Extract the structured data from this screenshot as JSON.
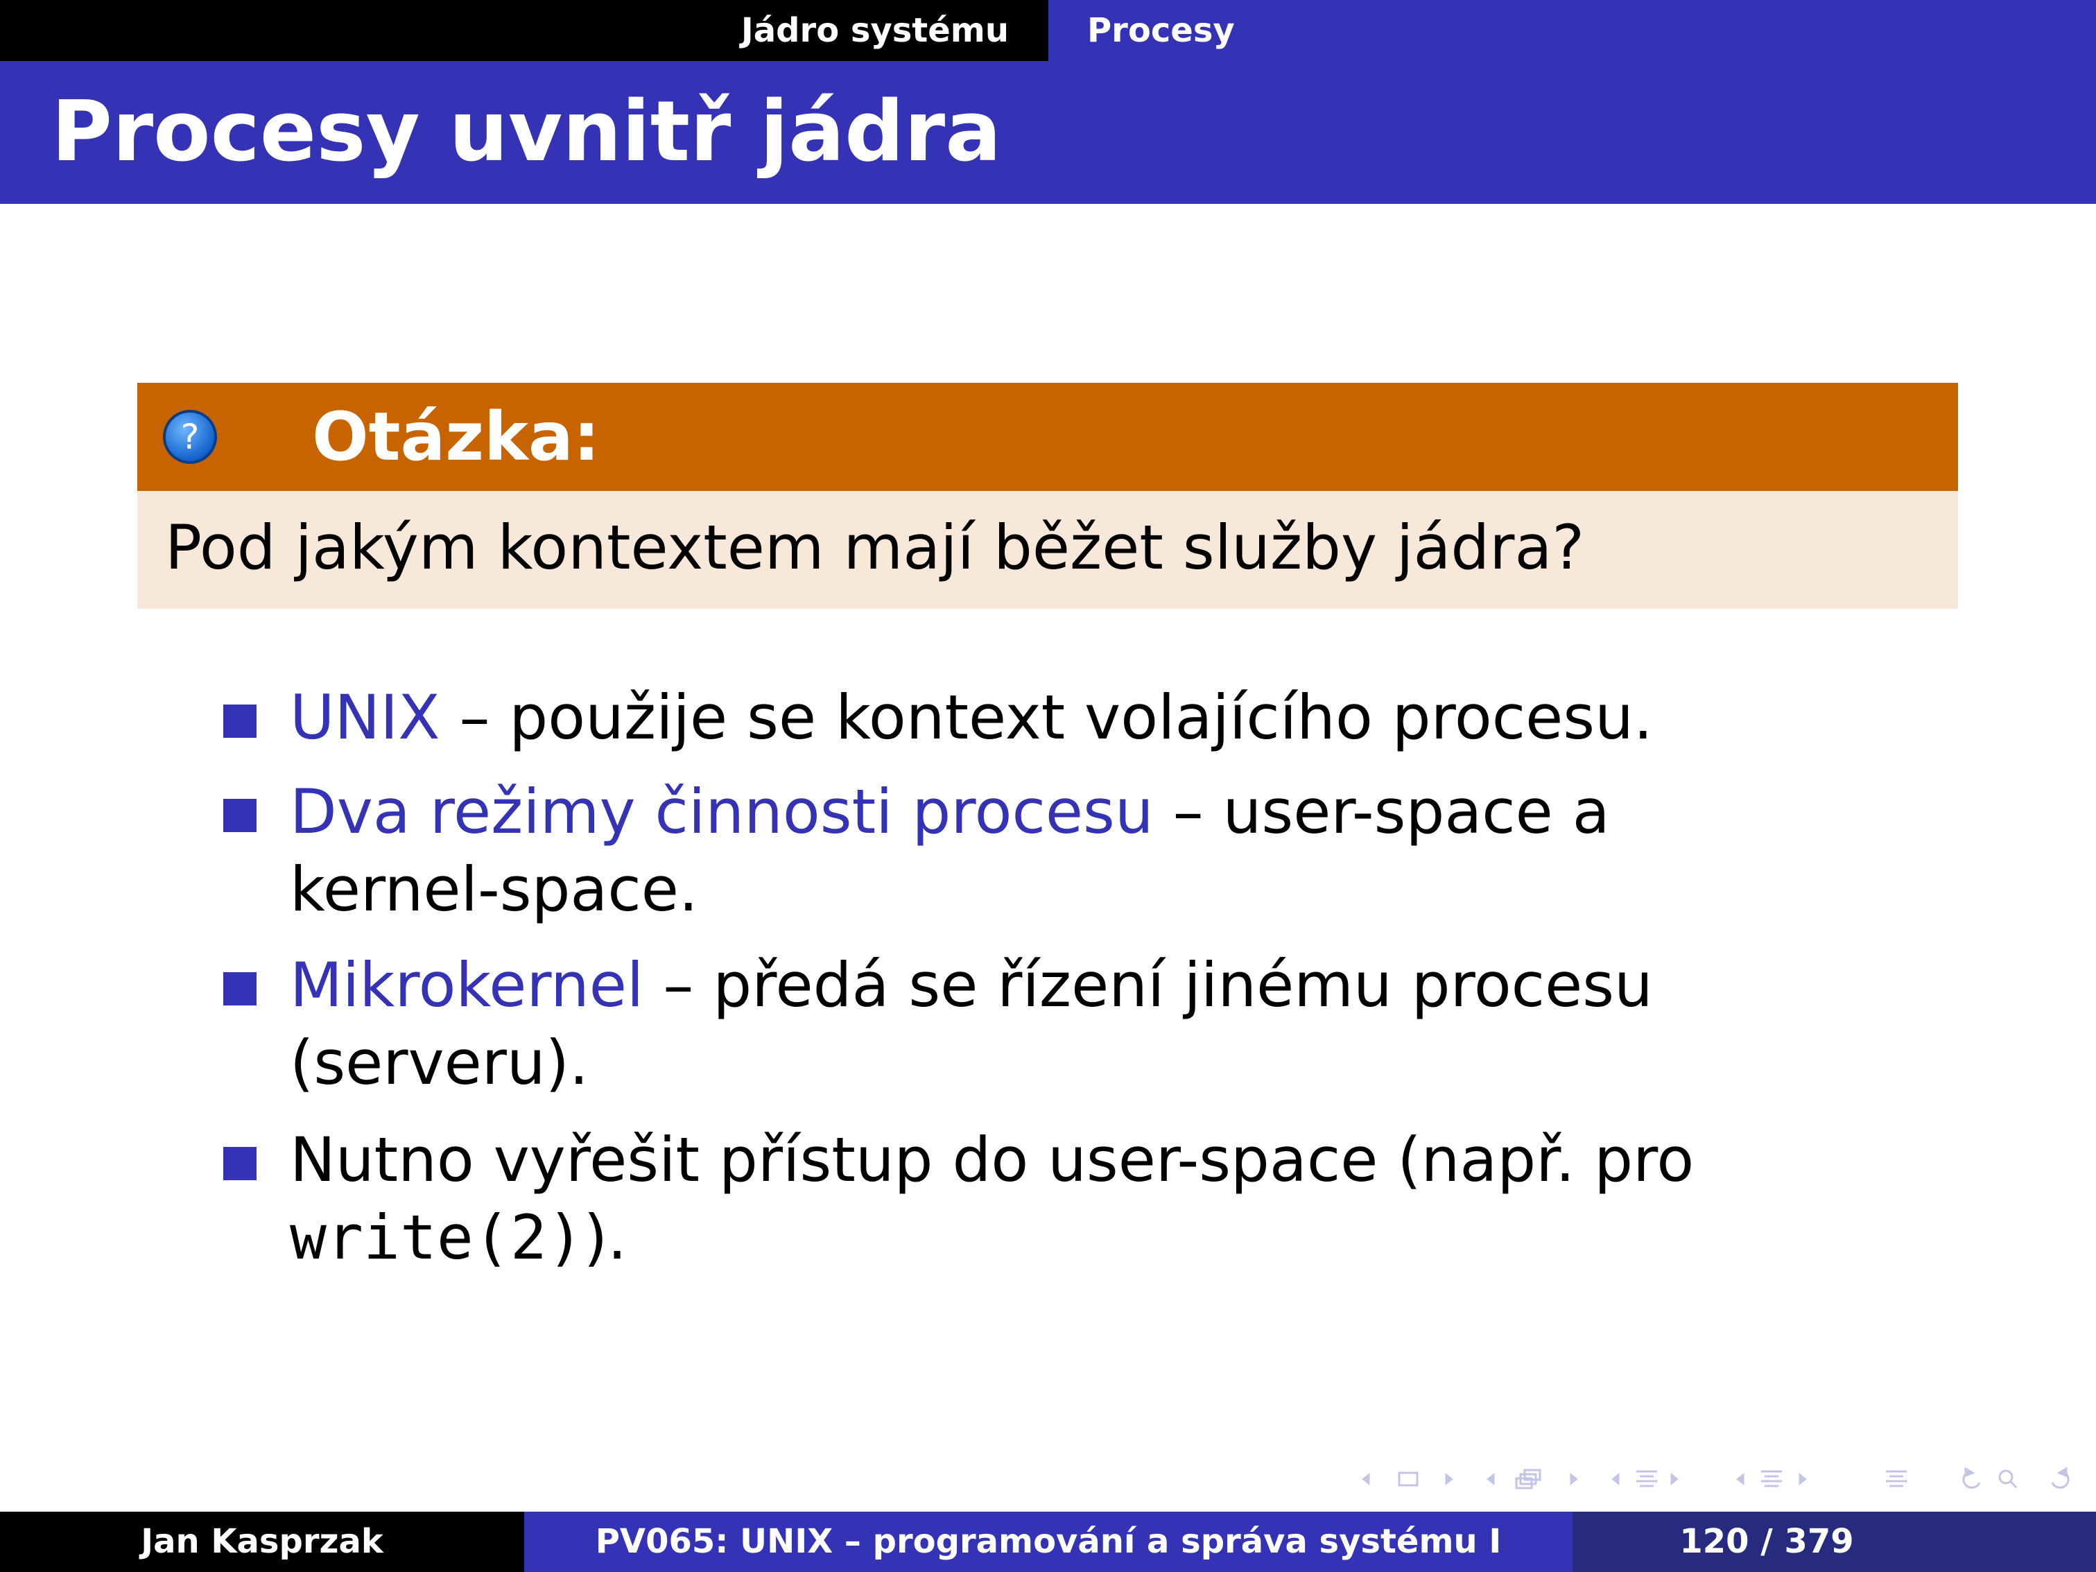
{
  "nav": {
    "section": "Jádro systému",
    "subsection": "Procesy"
  },
  "title": "Procesy uvnitř jádra",
  "question": {
    "title": "Otázka:",
    "icon": "question-icon",
    "text": "Pod jakým kontextem mají běžet služby jádra?"
  },
  "items": [
    {
      "term": "UNIX",
      "text": " – použije se kontext volajícího procesu."
    },
    {
      "term": "Dva režimy činnosti procesu",
      "text": " – user-space a",
      "text2": "kernel-space."
    },
    {
      "term": "Mikrokernel",
      "text": " – předá se řízení jinému procesu",
      "text2": "(serveru)."
    },
    {
      "text": "Nutno vyřešit přístup do user-space (např. pro",
      "code": "write(2)",
      "text2_suffix": ")."
    }
  ],
  "footer": {
    "author": "Jan Kasprzak",
    "course": "PV065: UNIX – programování a správa systému I",
    "page": "120 / 379"
  },
  "colors": {
    "primary": "#3533b5",
    "block_head": "#c86400",
    "block_body": "#f8e8d9"
  }
}
